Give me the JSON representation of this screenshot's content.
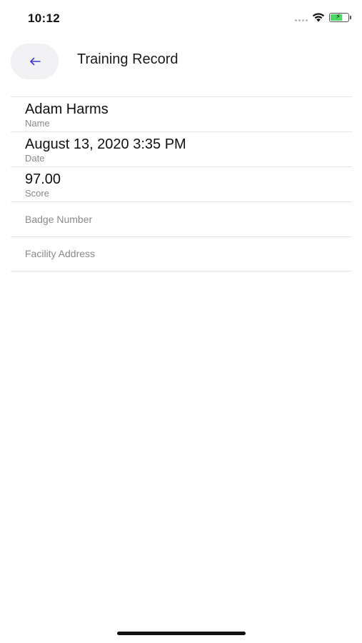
{
  "status_bar": {
    "time": "10:12",
    "icons": [
      "signal-dots-icon",
      "wifi-icon",
      "battery-charging-icon"
    ]
  },
  "header": {
    "back_icon": "arrow-left-icon",
    "title": "Training Record"
  },
  "fields": [
    {
      "value": "Adam Harms",
      "label": "Name"
    },
    {
      "value": "August 13, 2020 3:35 PM",
      "label": "Date"
    },
    {
      "value": "97.00",
      "label": "Score"
    },
    {
      "value": "",
      "label": "Badge Number"
    },
    {
      "value": "",
      "label": "Facility Address"
    }
  ],
  "colors": {
    "accent": "#3b3bd6",
    "divider": "#e6e6e6",
    "label": "#8a8a8e",
    "battery": "#4cd964"
  }
}
